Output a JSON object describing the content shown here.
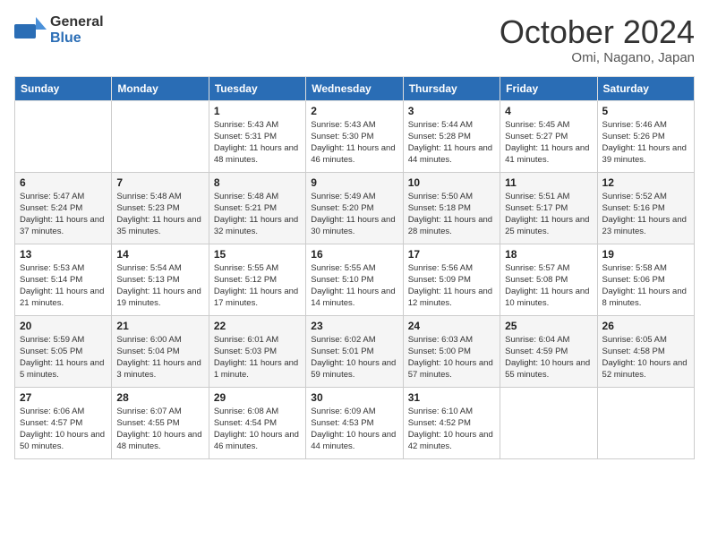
{
  "header": {
    "logo": {
      "text_general": "General",
      "text_blue": "Blue"
    },
    "month": "October 2024",
    "location": "Omi, Nagano, Japan"
  },
  "weekdays": [
    "Sunday",
    "Monday",
    "Tuesday",
    "Wednesday",
    "Thursday",
    "Friday",
    "Saturday"
  ],
  "weeks": [
    [
      {
        "day": "",
        "info": ""
      },
      {
        "day": "",
        "info": ""
      },
      {
        "day": "1",
        "info": "Sunrise: 5:43 AM\nSunset: 5:31 PM\nDaylight: 11 hours and 48 minutes."
      },
      {
        "day": "2",
        "info": "Sunrise: 5:43 AM\nSunset: 5:30 PM\nDaylight: 11 hours and 46 minutes."
      },
      {
        "day": "3",
        "info": "Sunrise: 5:44 AM\nSunset: 5:28 PM\nDaylight: 11 hours and 44 minutes."
      },
      {
        "day": "4",
        "info": "Sunrise: 5:45 AM\nSunset: 5:27 PM\nDaylight: 11 hours and 41 minutes."
      },
      {
        "day": "5",
        "info": "Sunrise: 5:46 AM\nSunset: 5:26 PM\nDaylight: 11 hours and 39 minutes."
      }
    ],
    [
      {
        "day": "6",
        "info": "Sunrise: 5:47 AM\nSunset: 5:24 PM\nDaylight: 11 hours and 37 minutes."
      },
      {
        "day": "7",
        "info": "Sunrise: 5:48 AM\nSunset: 5:23 PM\nDaylight: 11 hours and 35 minutes."
      },
      {
        "day": "8",
        "info": "Sunrise: 5:48 AM\nSunset: 5:21 PM\nDaylight: 11 hours and 32 minutes."
      },
      {
        "day": "9",
        "info": "Sunrise: 5:49 AM\nSunset: 5:20 PM\nDaylight: 11 hours and 30 minutes."
      },
      {
        "day": "10",
        "info": "Sunrise: 5:50 AM\nSunset: 5:18 PM\nDaylight: 11 hours and 28 minutes."
      },
      {
        "day": "11",
        "info": "Sunrise: 5:51 AM\nSunset: 5:17 PM\nDaylight: 11 hours and 25 minutes."
      },
      {
        "day": "12",
        "info": "Sunrise: 5:52 AM\nSunset: 5:16 PM\nDaylight: 11 hours and 23 minutes."
      }
    ],
    [
      {
        "day": "13",
        "info": "Sunrise: 5:53 AM\nSunset: 5:14 PM\nDaylight: 11 hours and 21 minutes."
      },
      {
        "day": "14",
        "info": "Sunrise: 5:54 AM\nSunset: 5:13 PM\nDaylight: 11 hours and 19 minutes."
      },
      {
        "day": "15",
        "info": "Sunrise: 5:55 AM\nSunset: 5:12 PM\nDaylight: 11 hours and 17 minutes."
      },
      {
        "day": "16",
        "info": "Sunrise: 5:55 AM\nSunset: 5:10 PM\nDaylight: 11 hours and 14 minutes."
      },
      {
        "day": "17",
        "info": "Sunrise: 5:56 AM\nSunset: 5:09 PM\nDaylight: 11 hours and 12 minutes."
      },
      {
        "day": "18",
        "info": "Sunrise: 5:57 AM\nSunset: 5:08 PM\nDaylight: 11 hours and 10 minutes."
      },
      {
        "day": "19",
        "info": "Sunrise: 5:58 AM\nSunset: 5:06 PM\nDaylight: 11 hours and 8 minutes."
      }
    ],
    [
      {
        "day": "20",
        "info": "Sunrise: 5:59 AM\nSunset: 5:05 PM\nDaylight: 11 hours and 5 minutes."
      },
      {
        "day": "21",
        "info": "Sunrise: 6:00 AM\nSunset: 5:04 PM\nDaylight: 11 hours and 3 minutes."
      },
      {
        "day": "22",
        "info": "Sunrise: 6:01 AM\nSunset: 5:03 PM\nDaylight: 11 hours and 1 minute."
      },
      {
        "day": "23",
        "info": "Sunrise: 6:02 AM\nSunset: 5:01 PM\nDaylight: 10 hours and 59 minutes."
      },
      {
        "day": "24",
        "info": "Sunrise: 6:03 AM\nSunset: 5:00 PM\nDaylight: 10 hours and 57 minutes."
      },
      {
        "day": "25",
        "info": "Sunrise: 6:04 AM\nSunset: 4:59 PM\nDaylight: 10 hours and 55 minutes."
      },
      {
        "day": "26",
        "info": "Sunrise: 6:05 AM\nSunset: 4:58 PM\nDaylight: 10 hours and 52 minutes."
      }
    ],
    [
      {
        "day": "27",
        "info": "Sunrise: 6:06 AM\nSunset: 4:57 PM\nDaylight: 10 hours and 50 minutes."
      },
      {
        "day": "28",
        "info": "Sunrise: 6:07 AM\nSunset: 4:55 PM\nDaylight: 10 hours and 48 minutes."
      },
      {
        "day": "29",
        "info": "Sunrise: 6:08 AM\nSunset: 4:54 PM\nDaylight: 10 hours and 46 minutes."
      },
      {
        "day": "30",
        "info": "Sunrise: 6:09 AM\nSunset: 4:53 PM\nDaylight: 10 hours and 44 minutes."
      },
      {
        "day": "31",
        "info": "Sunrise: 6:10 AM\nSunset: 4:52 PM\nDaylight: 10 hours and 42 minutes."
      },
      {
        "day": "",
        "info": ""
      },
      {
        "day": "",
        "info": ""
      }
    ]
  ]
}
